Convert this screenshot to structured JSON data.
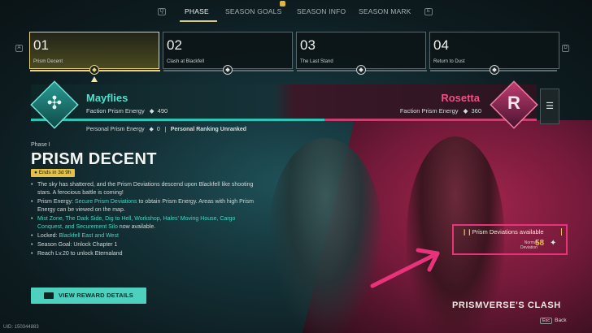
{
  "topnav": {
    "left_key": "Q",
    "right_key": "E",
    "tabs": [
      {
        "label": "PHASE"
      },
      {
        "label": "SEASON GOALS"
      },
      {
        "label": "SEASON INFO"
      },
      {
        "label": "SEASON MARK"
      }
    ]
  },
  "phases": {
    "prev_key": "A",
    "next_key": "D",
    "items": [
      {
        "num": "01",
        "name": "Prism Decent"
      },
      {
        "num": "02",
        "name": "Clash at Blackfell"
      },
      {
        "num": "03",
        "name": "The Last Stand"
      },
      {
        "num": "04",
        "name": "Return to Dust"
      }
    ]
  },
  "factions": {
    "left": {
      "name": "Mayflies",
      "energy_label": "Faction Prism Energy",
      "energy": "490",
      "emblem_glyph": "✣"
    },
    "right": {
      "name": "Rosetta",
      "energy_label": "Faction Prism Energy",
      "energy": "360",
      "emblem_glyph": "R"
    },
    "share_left": 0.58,
    "menu_icon": "☰"
  },
  "personal": {
    "energy_label": "Personal Prism Energy",
    "energy": "0",
    "ranking_label": "Personal Ranking",
    "ranking": "Unranked"
  },
  "phase_info": {
    "label": "Phase I",
    "title": "PRISM DECENT",
    "ends": "Ends in 3d 9h",
    "bullets": {
      "b1": "The sky has shattered, and the Prism Deviations descend upon Blackfell like shooting stars. A ferocious battle is coming!",
      "b2_prefix": "Prism Energy:",
      "b2_link": "Secure Prism Deviations",
      "b2_suffix": "to obtain Prism Energy. Areas with high Prism Energy can be viewed on the map.",
      "b3_link": "Mist Zone, The Dark Side, Dig to Hell, Workshop, Hales' Moving House, Cargo Conquest, and Securement Silo",
      "b3_suffix": "now available.",
      "b4_prefix": "Locked:",
      "b4_link": "Blackfell East and West",
      "b5": "Season Goal: Unlock Chapter 1",
      "b6": "Reach Lv.20 to unlock Eternaland"
    },
    "reward_button": "VIEW REWARD DETAILS"
  },
  "deviation": {
    "title": "Prism Deviations available",
    "normal_label": "Normal",
    "deviation_label": "Deviation",
    "count": "58"
  },
  "event_name": "PRISMVERSE'S CLASH",
  "uid": "UID: 150344883",
  "back": {
    "key": "Esc",
    "label": "Back"
  },
  "colors": {
    "accent_teal": "#4ed0bf",
    "accent_pink": "#e8337a",
    "accent_gold": "#e3c14a"
  }
}
